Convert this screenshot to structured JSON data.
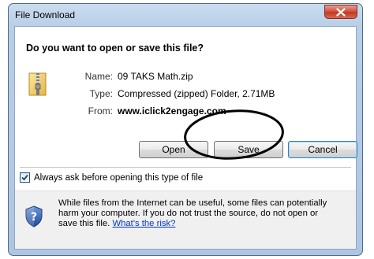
{
  "window": {
    "title": "File Download"
  },
  "dialog": {
    "question": "Do you want to open or save this file?",
    "file": {
      "name_label": "Name:",
      "name_value": "09 TAKS Math.zip",
      "type_label": "Type:",
      "type_value": "Compressed (zipped) Folder, 2.71MB",
      "from_label": "From:",
      "from_value": "www.iclick2engage.com"
    },
    "buttons": {
      "open": "Open",
      "save": "Save",
      "cancel": "Cancel"
    },
    "checkbox": {
      "label": "Always ask before opening this type of file",
      "checked": true
    },
    "warning": {
      "line1": "While files from the Internet can be useful, some files can potentially",
      "line2": "harm your computer. If you do not trust the source, do not open or",
      "line3": "save this file.",
      "link": "What's the risk?"
    }
  },
  "icons": {
    "close": "close-icon",
    "file": "zip-folder-icon",
    "checkbox": "checkmark-icon",
    "security": "shield-question-icon"
  },
  "colors": {
    "close_button": "#c94a33",
    "link": "#0033cc",
    "frame": "#b9cfe8",
    "annotation": "#000000"
  }
}
